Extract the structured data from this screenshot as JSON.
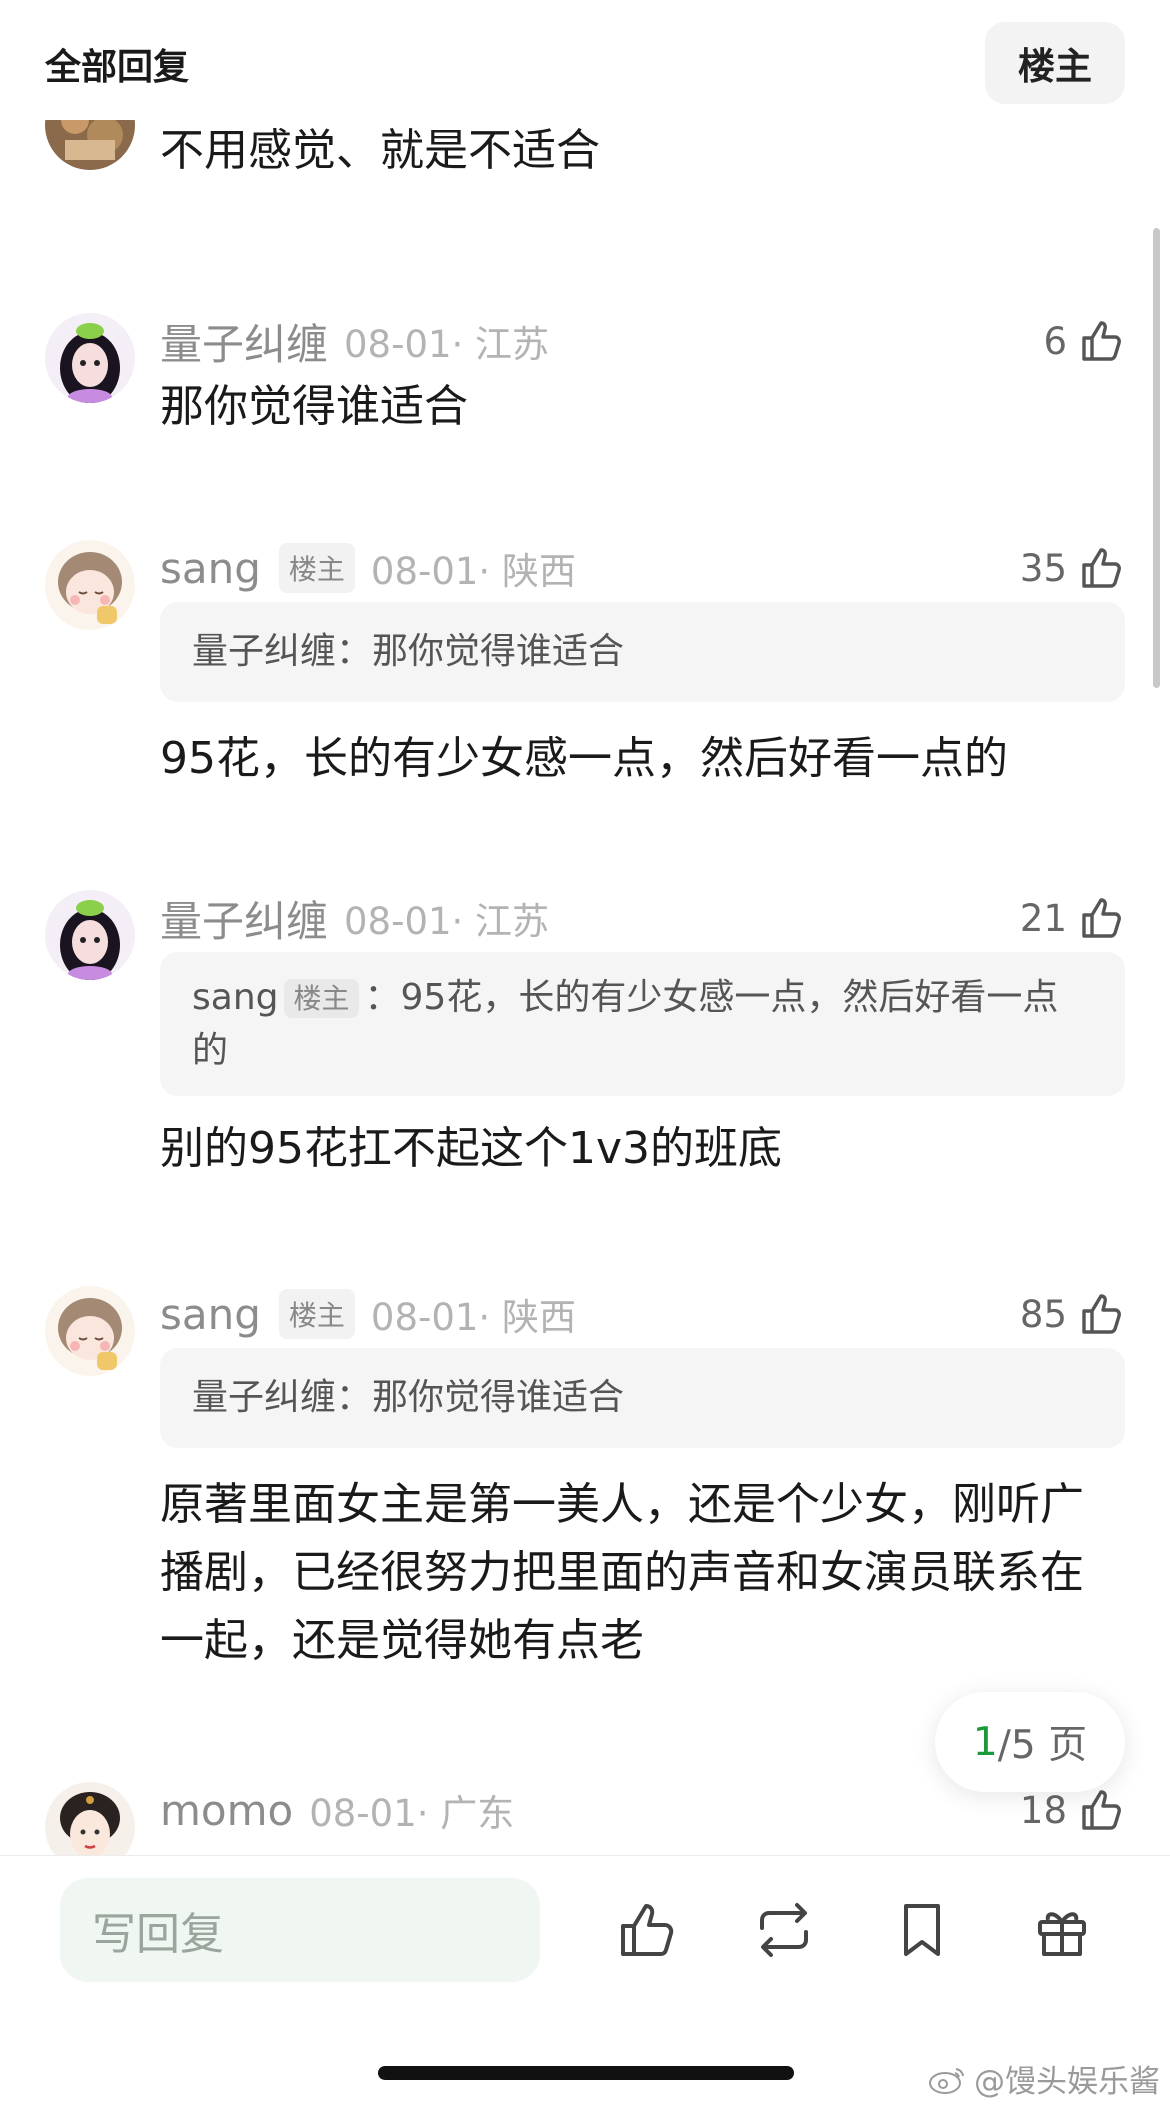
{
  "header": {
    "title": "全部回复",
    "op_filter": "楼主"
  },
  "comments": [
    {
      "id": "c0",
      "user": "",
      "is_op": false,
      "date": "",
      "likes": "",
      "quote": null,
      "text": "不用感觉、就是不适合"
    },
    {
      "id": "c1",
      "user": "量子纠缠",
      "is_op": false,
      "date": "08-01· 江苏",
      "likes": "6",
      "quote": null,
      "text": "那你觉得谁适合"
    },
    {
      "id": "c2",
      "user": "sang",
      "is_op": true,
      "op_label": "楼主",
      "date": "08-01· 陕西",
      "likes": "35",
      "quote": {
        "user": "量子纠缠",
        "sep": "：",
        "text": "那你觉得谁适合"
      },
      "text": "95花，长的有少女感一点，然后好看一点的"
    },
    {
      "id": "c3",
      "user": "量子纠缠",
      "is_op": false,
      "date": "08-01· 江苏",
      "likes": "21",
      "quote": {
        "user": "sang",
        "badge": "楼主",
        "sep": "：",
        "text": "95花，长的有少女感一点，然后好看一点的"
      },
      "text": "别的95花扛不起这个1v3的班底"
    },
    {
      "id": "c4",
      "user": "sang",
      "is_op": true,
      "op_label": "楼主",
      "date": "08-01· 陕西",
      "likes": "85",
      "quote": {
        "user": "量子纠缠",
        "sep": "：",
        "text": "那你觉得谁适合"
      },
      "text": "原著里面女主是第一美人，还是个少女，刚听广播剧，已经很努力把里面的声音和女演员联系在一起，还是觉得她有点老"
    },
    {
      "id": "c5",
      "user": "momo",
      "is_op": false,
      "date": "08-01· 广东",
      "likes": "18",
      "quote": null,
      "text": ""
    }
  ],
  "pagination": {
    "current": "1",
    "total": "/5 页"
  },
  "bottom_bar": {
    "reply_placeholder": "写回复",
    "icons": [
      "like-icon",
      "repost-icon",
      "bookmark-icon",
      "gift-icon"
    ]
  },
  "watermark": "@馒头娱乐酱",
  "colors": {
    "accent_green": "#1a9a3a",
    "reply_bg": "#f0f6f1",
    "quote_bg": "#f5f5f5"
  }
}
